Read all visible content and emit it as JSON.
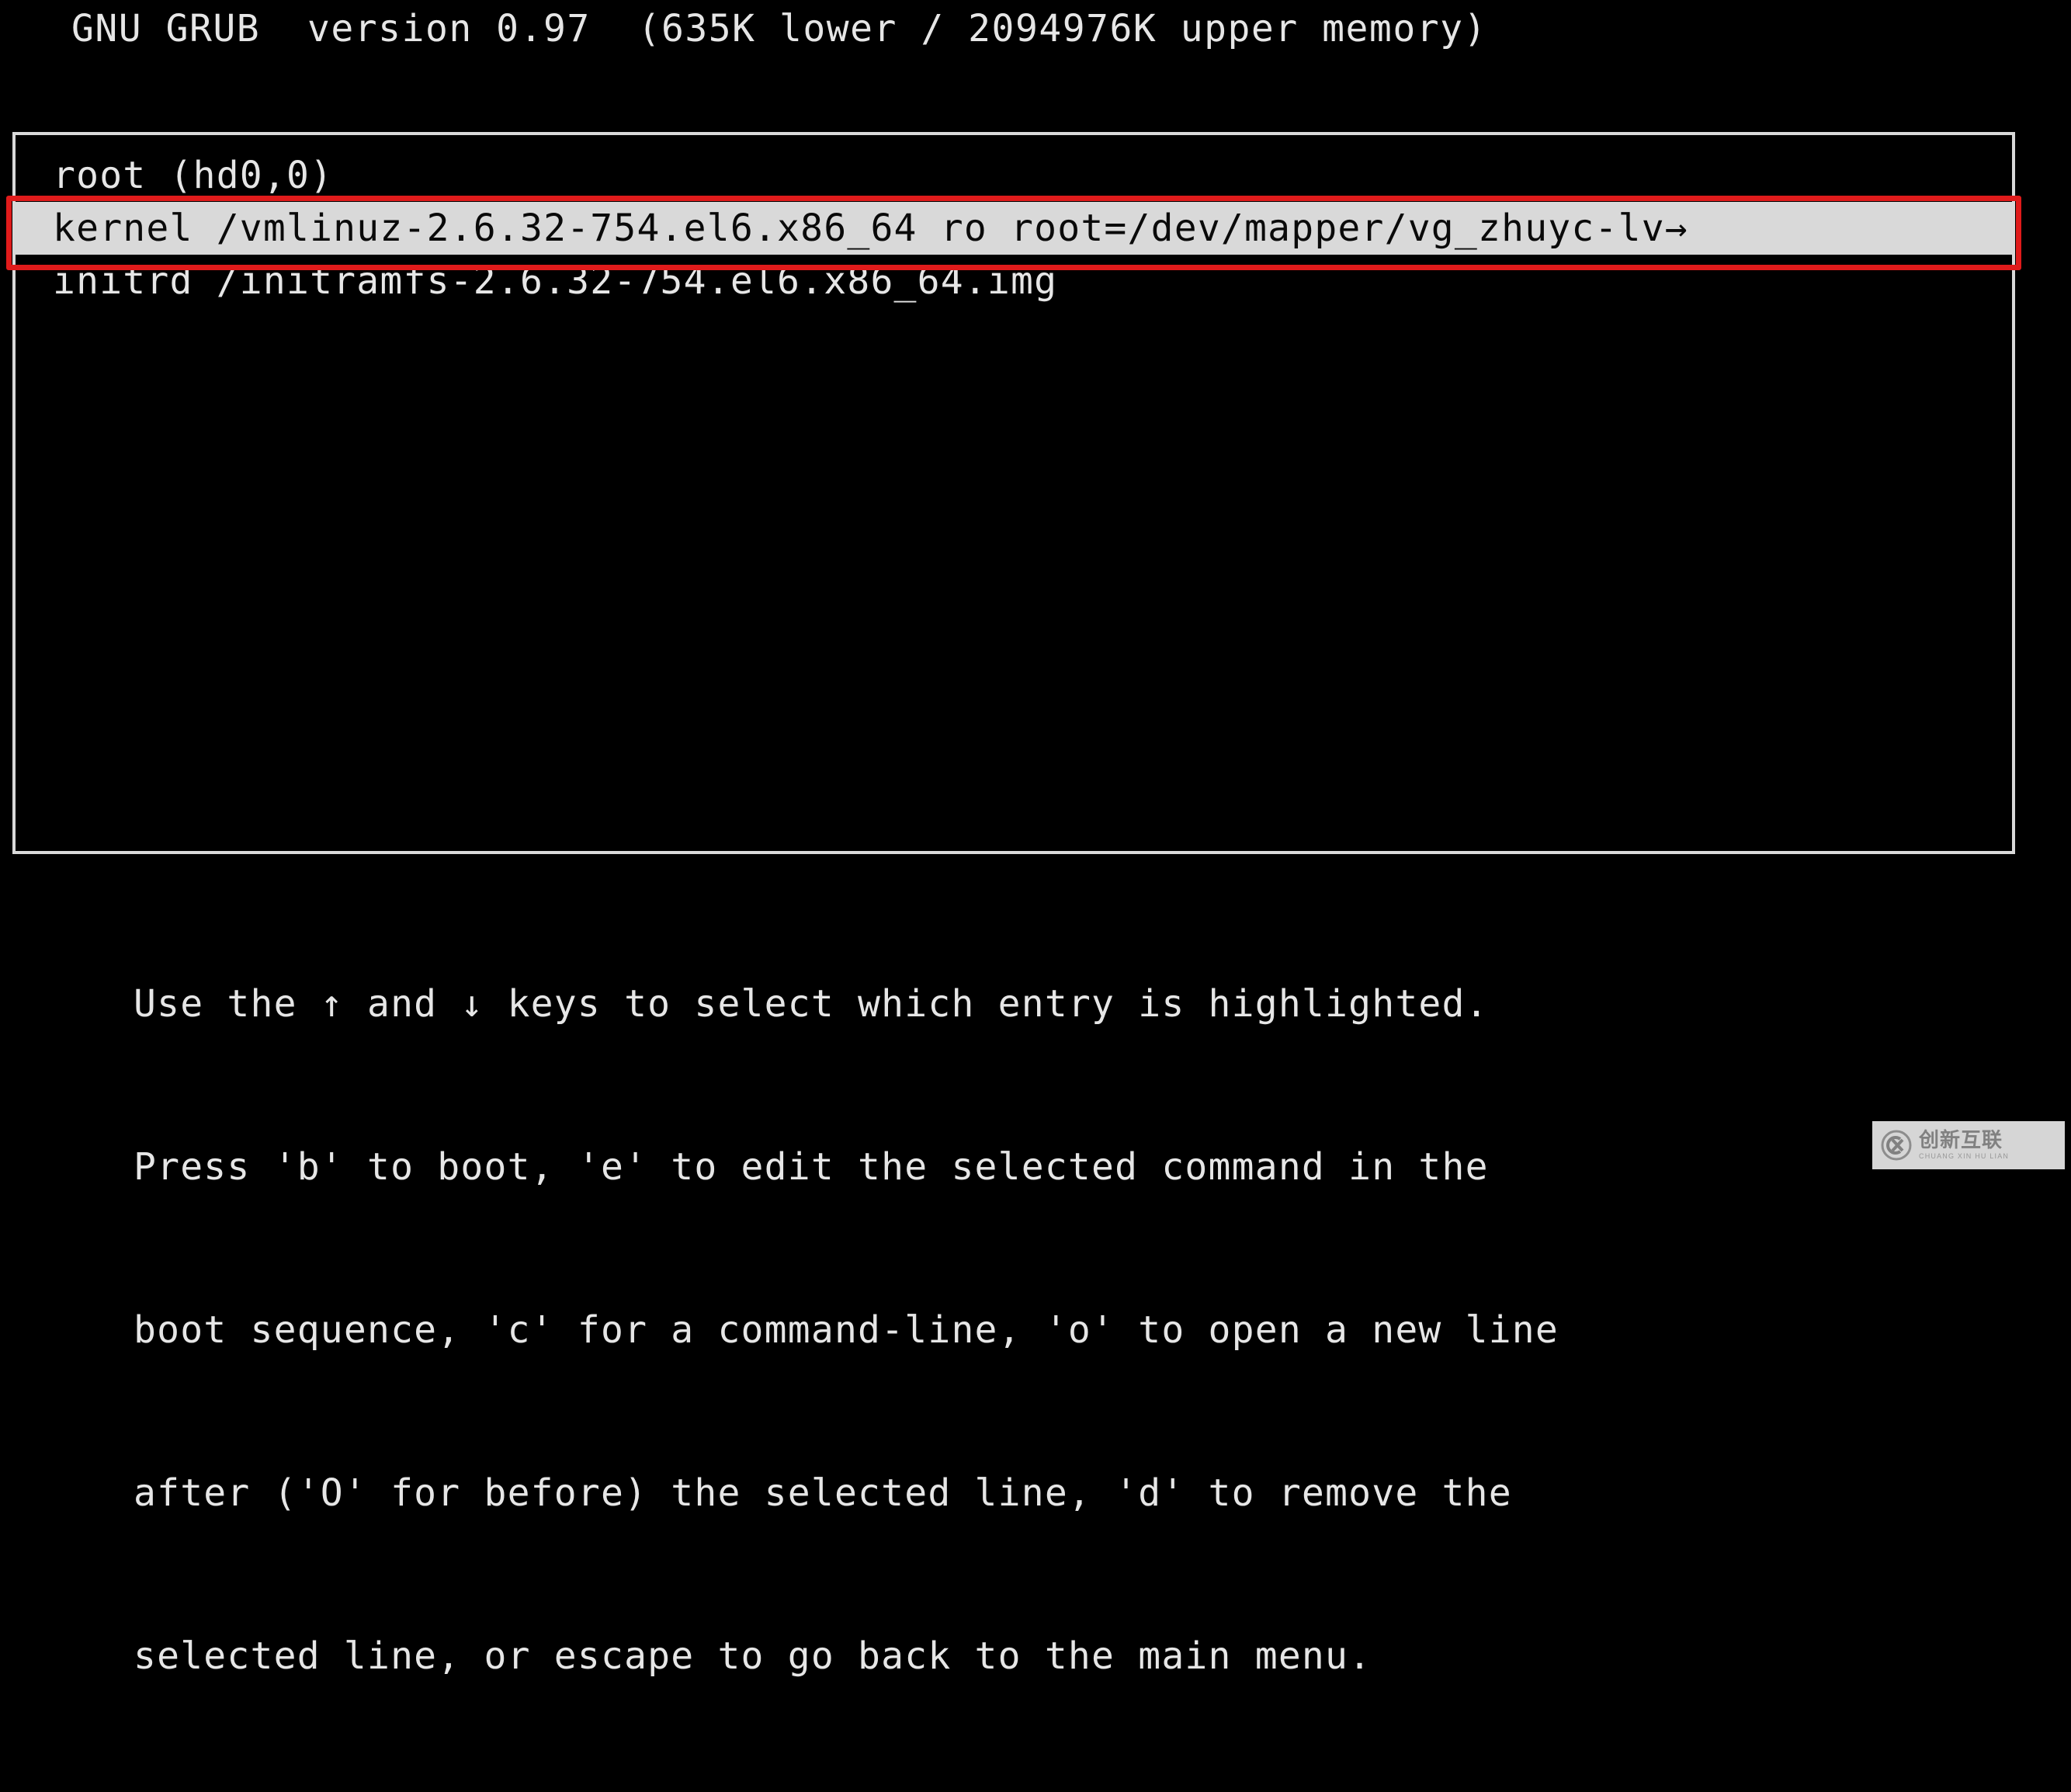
{
  "header": {
    "title": "GNU GRUB  version 0.97  (635K lower / 2094976K upper memory)"
  },
  "menu": {
    "entries": [
      {
        "text": "root (hd0,0)",
        "selected": false
      },
      {
        "text": "kernel /vmlinuz-2.6.32-754.el6.x86_64 ro root=/dev/mapper/vg_zhuyc-lv→",
        "selected": true
      },
      {
        "text": "initrd /initramfs-2.6.32-754.el6.x86_64.img",
        "selected": false
      }
    ]
  },
  "help": {
    "lines": [
      "Use the ↑ and ↓ keys to select which entry is highlighted.",
      "Press 'b' to boot, 'e' to edit the selected command in the",
      "boot sequence, 'c' for a command-line, 'o' to open a new line",
      "after ('O' for before) the selected line, 'd' to remove the",
      "selected line, or escape to go back to the main menu."
    ]
  },
  "annotation": {
    "color": "#e01b1b",
    "target": "kernel-line"
  },
  "watermark": {
    "name_cn": "创新互联",
    "name_pinyin": "CHUANG XIN HU LIAN",
    "logo_letters": "CX"
  },
  "colors": {
    "background": "#000000",
    "foreground": "#e6e6e6",
    "highlight_bg": "#d9d9d9",
    "highlight_fg": "#0a0a0a",
    "annotation": "#e01b1b"
  }
}
